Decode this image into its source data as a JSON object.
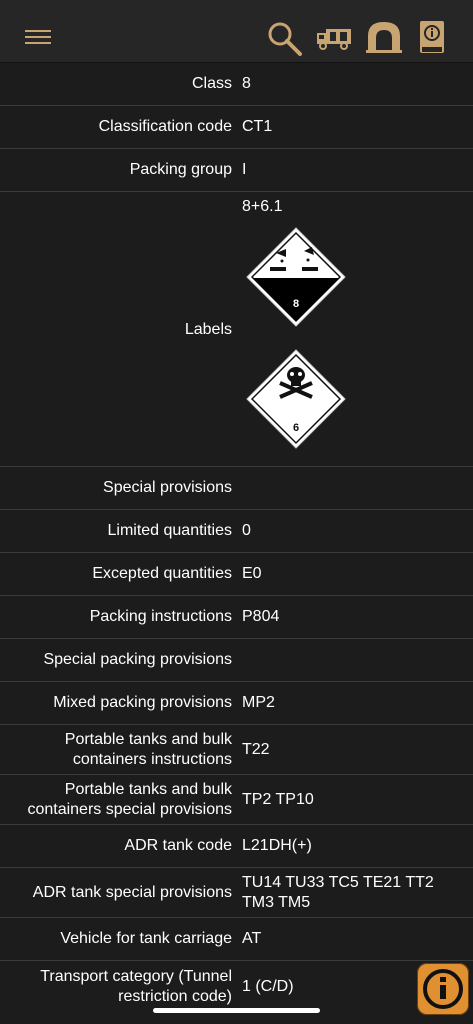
{
  "toolbar": {
    "icons": [
      "menu-icon",
      "search-icon",
      "truck-icon",
      "tunnel-icon",
      "info-book-icon"
    ]
  },
  "rows": [
    {
      "label": "Class",
      "value": "8"
    },
    {
      "label": "Classification code",
      "value": "CT1"
    },
    {
      "label": "Packing group",
      "value": "I"
    },
    {
      "label": "Labels",
      "value": "8+6.1"
    },
    {
      "label": "Special provisions",
      "value": ""
    },
    {
      "label": "Limited quantities",
      "value": "0"
    },
    {
      "label": "Excepted quantities",
      "value": "E0"
    },
    {
      "label": "Packing instructions",
      "value": "P804"
    },
    {
      "label": "Special packing provisions",
      "value": ""
    },
    {
      "label": "Mixed packing provisions",
      "value": "MP2"
    },
    {
      "label": "Portable tanks and bulk containers instructions",
      "value": "T22"
    },
    {
      "label": "Portable tanks and bulk containers special provisions",
      "value": "TP2 TP10"
    },
    {
      "label": "ADR tank code",
      "value": "L21DH(+)"
    },
    {
      "label": "ADR tank special provisions",
      "value": "TU14 TU33 TC5 TE21 TT2 TM3 TM5"
    },
    {
      "label": "Vehicle for tank carriage",
      "value": "AT"
    },
    {
      "label": "Transport category (Tunnel restriction code)",
      "value": "1 (C/D)"
    }
  ],
  "hazard_labels": [
    {
      "number": "8",
      "kind": "corrosive"
    },
    {
      "number": "6",
      "kind": "toxic"
    }
  ]
}
